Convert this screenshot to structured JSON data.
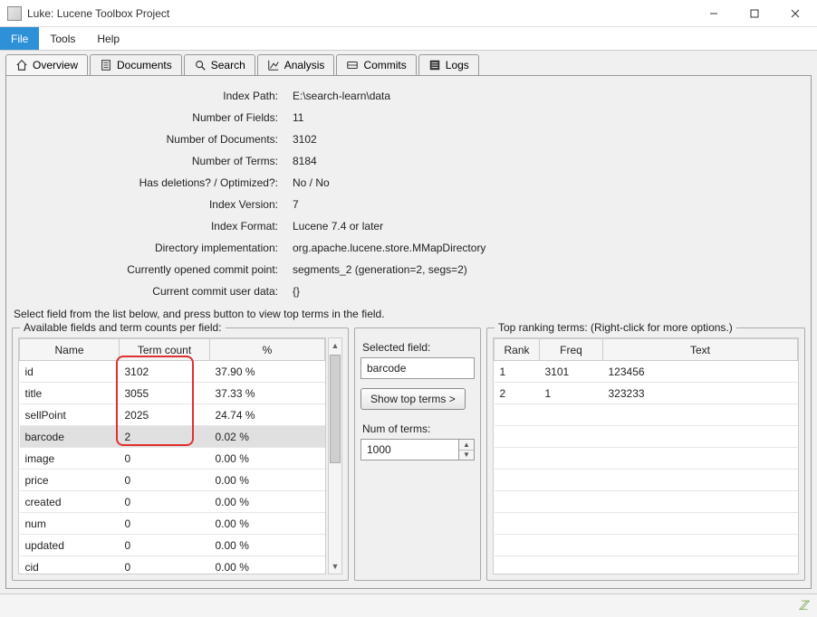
{
  "window": {
    "title": "Luke: Lucene Toolbox Project"
  },
  "menubar": {
    "file": "File",
    "tools": "Tools",
    "help": "Help"
  },
  "tabs": {
    "overview": "Overview",
    "documents": "Documents",
    "search": "Search",
    "analysis": "Analysis",
    "commits": "Commits",
    "logs": "Logs"
  },
  "details": {
    "labels": {
      "index_path": "Index Path:",
      "num_fields": "Number of Fields:",
      "num_docs": "Number of Documents:",
      "num_terms": "Number of Terms:",
      "deletions": "Has deletions? / Optimized?:",
      "version": "Index Version:",
      "format": "Index Format:",
      "dir_impl": "Directory implementation:",
      "commit_point": "Currently opened commit point:",
      "user_data": "Current commit user data:"
    },
    "values": {
      "index_path": "E:\\search-learn\\data",
      "num_fields": "11",
      "num_docs": "3102",
      "num_terms": "8184",
      "deletions": "No / No",
      "version": "7",
      "format": "Lucene 7.4 or later",
      "dir_impl": "org.apache.lucene.store.MMapDirectory",
      "commit_point": "segments_2 (generation=2, segs=2)",
      "user_data": "{}"
    }
  },
  "instruction": "Select field from the list below, and press button to view top terms in the field.",
  "fields_box": {
    "legend": "Available fields and term counts per field:",
    "headers": {
      "name": "Name",
      "term_count": "Term count",
      "pct": "%"
    },
    "rows": [
      {
        "name": "id",
        "count": "3102",
        "pct": "37.90 %"
      },
      {
        "name": "title",
        "count": "3055",
        "pct": "37.33 %"
      },
      {
        "name": "sellPoint",
        "count": "2025",
        "pct": "24.74 %"
      },
      {
        "name": "barcode",
        "count": "2",
        "pct": "0.02 %",
        "selected": true
      },
      {
        "name": "image",
        "count": "0",
        "pct": "0.00 %"
      },
      {
        "name": "price",
        "count": "0",
        "pct": "0.00 %"
      },
      {
        "name": "created",
        "count": "0",
        "pct": "0.00 %"
      },
      {
        "name": "num",
        "count": "0",
        "pct": "0.00 %"
      },
      {
        "name": "updated",
        "count": "0",
        "pct": "0.00 %"
      },
      {
        "name": "cid",
        "count": "0",
        "pct": "0.00 %"
      }
    ]
  },
  "mid": {
    "selected_label": "Selected field:",
    "selected_value": "barcode",
    "show_btn": "Show top terms >",
    "num_label": "Num of terms:",
    "num_value": "1000"
  },
  "terms_box": {
    "legend": "Top ranking terms: (Right-click for more options.)",
    "headers": {
      "rank": "Rank",
      "freq": "Freq",
      "text": "Text"
    },
    "rows": [
      {
        "rank": "1",
        "freq": "3101",
        "text": "123456"
      },
      {
        "rank": "2",
        "freq": "1",
        "text": "323233"
      }
    ]
  }
}
